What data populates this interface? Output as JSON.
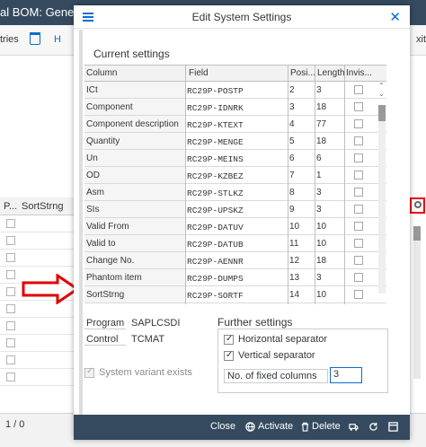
{
  "background": {
    "title": "al BOM: General",
    "toolbar_left": "tries",
    "toolbar_h": "H",
    "toolbar_right": "xit",
    "grid_headers": [
      "P...",
      "SortStrng"
    ],
    "pager": "1 / 0"
  },
  "dialog": {
    "title": "Edit System Settings",
    "current_settings_title": "Current settings",
    "columns": [
      "Column",
      "Field",
      "Posi...",
      "Length",
      "Invis..."
    ],
    "rows": [
      {
        "column": "ICt",
        "field": "RC29P-POSTP",
        "pos": "2",
        "length": "3"
      },
      {
        "column": "Component",
        "field": "RC29P-IDNRK",
        "pos": "3",
        "length": "18"
      },
      {
        "column": "Component description",
        "field": "RC29P-KTEXT",
        "pos": "4",
        "length": "77"
      },
      {
        "column": "Quantity",
        "field": "RC29P-MENGE",
        "pos": "5",
        "length": "18"
      },
      {
        "column": "Un",
        "field": "RC29P-MEINS",
        "pos": "6",
        "length": "6"
      },
      {
        "column": "OD",
        "field": "RC29P-KZBEZ",
        "pos": "7",
        "length": "1"
      },
      {
        "column": "Asm",
        "field": "RC29P-STLKZ",
        "pos": "8",
        "length": "3"
      },
      {
        "column": "SIs",
        "field": "RC29P-UPSKZ",
        "pos": "9",
        "length": "3"
      },
      {
        "column": "Valid From",
        "field": "RC29P-DATUV",
        "pos": "10",
        "length": "10"
      },
      {
        "column": "Valid to",
        "field": "RC29P-DATUB",
        "pos": "11",
        "length": "10"
      },
      {
        "column": "Change No.",
        "field": "RC29P-AENNR",
        "pos": "12",
        "length": "18"
      },
      {
        "column": "Phantom item",
        "field": "RC29P-DUMPS",
        "pos": "13",
        "length": "3"
      },
      {
        "column": "SortStrng",
        "field": "RC29P-SORTF",
        "pos": "14",
        "length": "10"
      }
    ],
    "program_label": "Program",
    "program_value": "SAPLCSDI",
    "control_label": "Control",
    "control_value": "TCMAT",
    "system_variant": "System variant exists",
    "further_title": "Further settings",
    "horizontal_sep": "Horizontal separator",
    "vertical_sep": "Vertical separator",
    "fixed_cols_label": "No. of fixed columns",
    "fixed_cols_value": "3",
    "footer": {
      "close": "Close",
      "activate": "Activate",
      "delete": "Delete"
    }
  },
  "colors": {
    "shell": "#354a5f",
    "accent": "#0a6ed1",
    "highlight": "#e00000"
  }
}
